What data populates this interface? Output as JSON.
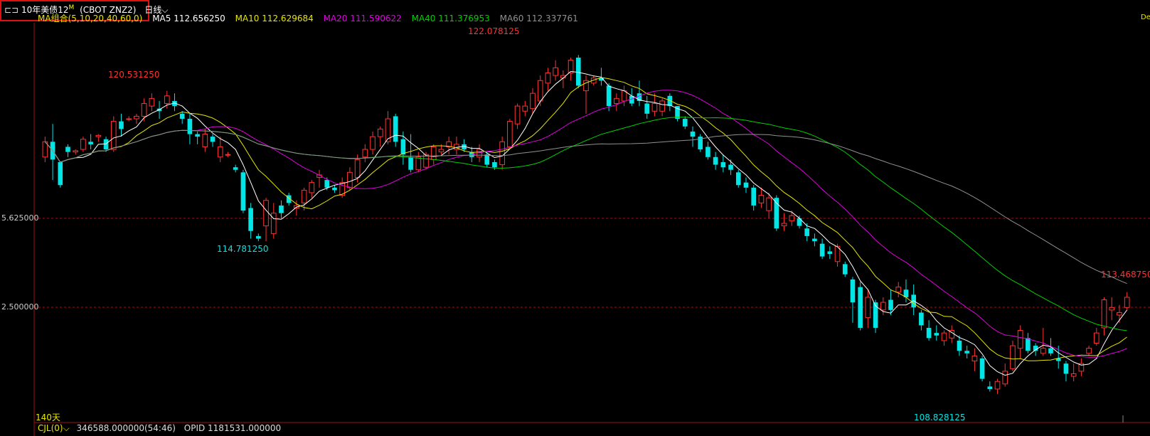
{
  "header": {
    "symbol_prefix": "10年美债12",
    "symbol_sup": "M",
    "symbol_code": "(CBOT ZNZ2)",
    "period": "日线",
    "period_arrow": "⌵"
  },
  "ma_bar": {
    "group": "MA组合(5,10,20,40,60,0)",
    "ma5": "MA5 112.656250",
    "ma10": "MA10 112.629684",
    "ma20": "MA20 111.590622",
    "ma40": "MA40 111.376953",
    "ma60": "MA60 112.337761"
  },
  "y_axis": {
    "label_1": "5.625000",
    "label_2": "2.500000"
  },
  "annotations": {
    "high": "122.078125",
    "peak_left": "120.531250",
    "low_left": "114.781250",
    "low": "108.828125",
    "last": "113.468750",
    "count": "140天",
    "corner": "De"
  },
  "indicator_bar": {
    "name": "CJL(0)",
    "arrow": "⌵",
    "value": "346588.000000(54:46)",
    "opid": "OPID 1181531.000000"
  },
  "colors": {
    "up": "#ff3232",
    "down": "#00e5e5",
    "ma5": "#ffffff",
    "ma10": "#e6e600",
    "ma20": "#e000e0",
    "ma40": "#00d000",
    "ma60": "#909090",
    "grid": "#a01010"
  },
  "chart_data": {
    "type": "candlestick",
    "price_range": [
      107.8,
      123.2
    ],
    "bars": [
      [
        118.1,
        118.9,
        117.9,
        118.7
      ],
      [
        118.7,
        119.4,
        117.2,
        118.0
      ],
      [
        117.9,
        117.9,
        116.9,
        117.0
      ],
      [
        118.5,
        118.6,
        118.1,
        118.3
      ],
      [
        118.3,
        118.4,
        118.2,
        118.35
      ],
      [
        118.4,
        118.9,
        118.3,
        118.8
      ],
      [
        118.7,
        119.0,
        118.4,
        118.6
      ],
      [
        118.9,
        119.0,
        118.7,
        118.95
      ],
      [
        118.8,
        118.9,
        118.3,
        118.4
      ],
      [
        118.4,
        119.7,
        118.3,
        119.5
      ],
      [
        119.5,
        119.8,
        118.9,
        119.2
      ],
      [
        119.6,
        119.7,
        119.5,
        119.6
      ],
      [
        119.6,
        119.8,
        119.4,
        119.7
      ],
      [
        119.7,
        120.4,
        119.5,
        120.2
      ],
      [
        120.1,
        120.6,
        119.9,
        120.4
      ],
      [
        120.0,
        120.3,
        119.6,
        119.9
      ],
      [
        120.2,
        120.7,
        120.0,
        120.5
      ],
      [
        120.3,
        120.6,
        119.9,
        120.1
      ],
      [
        119.8,
        119.9,
        119.4,
        119.6
      ],
      [
        119.6,
        119.8,
        118.6,
        119.0
      ],
      [
        119.0,
        119.1,
        118.6,
        118.9
      ],
      [
        118.5,
        119.2,
        118.3,
        119.0
      ],
      [
        118.9,
        119.0,
        118.5,
        118.7
      ],
      [
        118.1,
        118.9,
        117.9,
        118.5
      ],
      [
        118.2,
        118.3,
        118.1,
        118.2
      ],
      [
        117.7,
        117.8,
        117.5,
        117.6
      ],
      [
        117.5,
        117.6,
        115.9,
        116.0
      ],
      [
        116.1,
        116.3,
        114.9,
        115.2
      ],
      [
        115.0,
        115.1,
        114.8,
        114.9
      ],
      [
        115.4,
        116.5,
        114.8,
        116.4
      ],
      [
        115.1,
        116.3,
        114.9,
        115.9
      ],
      [
        116.2,
        116.4,
        115.7,
        115.9
      ],
      [
        116.6,
        116.7,
        116.2,
        116.3
      ],
      [
        116.1,
        116.4,
        115.8,
        116.2
      ],
      [
        116.3,
        116.9,
        116.0,
        116.8
      ],
      [
        116.7,
        117.2,
        116.5,
        117.1
      ],
      [
        117.3,
        117.6,
        116.9,
        117.4
      ],
      [
        117.2,
        117.3,
        116.8,
        116.9
      ],
      [
        116.9,
        117.0,
        116.7,
        116.8
      ],
      [
        116.6,
        117.3,
        116.5,
        117.1
      ],
      [
        116.9,
        117.7,
        116.8,
        117.5
      ],
      [
        117.3,
        118.2,
        117.1,
        118.0
      ],
      [
        118.1,
        118.6,
        117.9,
        118.4
      ],
      [
        118.4,
        119.1,
        118.2,
        118.9
      ],
      [
        118.9,
        119.3,
        118.5,
        119.2
      ],
      [
        118.7,
        119.9,
        118.6,
        119.6
      ],
      [
        119.7,
        119.8,
        118.5,
        118.7
      ],
      [
        118.8,
        119.1,
        117.8,
        118.2
      ],
      [
        118.1,
        119.0,
        117.5,
        117.6
      ],
      [
        117.6,
        118.3,
        117.5,
        118.1
      ],
      [
        117.7,
        118.3,
        117.6,
        118.2
      ],
      [
        118.0,
        118.6,
        117.8,
        118.5
      ],
      [
        118.3,
        118.6,
        118.2,
        118.4
      ],
      [
        118.5,
        118.9,
        118.2,
        118.7
      ],
      [
        118.4,
        118.9,
        118.2,
        118.6
      ],
      [
        118.6,
        118.8,
        118.3,
        118.4
      ],
      [
        118.3,
        118.5,
        117.9,
        118.1
      ],
      [
        118.1,
        118.6,
        117.9,
        118.4
      ],
      [
        118.2,
        118.3,
        117.7,
        117.8
      ],
      [
        117.9,
        118.0,
        117.6,
        117.7
      ],
      [
        117.8,
        118.9,
        117.6,
        118.7
      ],
      [
        118.5,
        119.6,
        118.4,
        119.5
      ],
      [
        119.4,
        120.2,
        119.2,
        120.1
      ],
      [
        119.9,
        120.3,
        119.7,
        120.1
      ],
      [
        120.0,
        120.8,
        119.8,
        120.6
      ],
      [
        120.3,
        121.3,
        120.1,
        121.1
      ],
      [
        121.0,
        121.6,
        120.7,
        121.4
      ],
      [
        121.3,
        121.9,
        121.1,
        121.6
      ],
      [
        121.2,
        121.5,
        120.8,
        121.3
      ],
      [
        121.4,
        122.0,
        121.1,
        121.9
      ],
      [
        122.0,
        122.1,
        120.8,
        120.9
      ],
      [
        120.7,
        121.3,
        119.8,
        121.1
      ],
      [
        121.0,
        121.3,
        120.9,
        121.2
      ],
      [
        121.2,
        121.6,
        120.9,
        121.1
      ],
      [
        120.9,
        121.0,
        119.9,
        120.1
      ],
      [
        120.2,
        120.6,
        119.9,
        120.4
      ],
      [
        120.3,
        120.9,
        120.1,
        120.7
      ],
      [
        120.5,
        120.8,
        120.1,
        120.2
      ],
      [
        120.6,
        121.1,
        120.1,
        120.3
      ],
      [
        120.2,
        120.5,
        119.6,
        119.8
      ],
      [
        119.9,
        120.6,
        119.7,
        120.2
      ],
      [
        119.9,
        120.4,
        119.7,
        120.3
      ],
      [
        120.5,
        120.6,
        119.9,
        120.1
      ],
      [
        120.1,
        120.1,
        119.5,
        119.6
      ],
      [
        119.6,
        119.7,
        119.2,
        119.3
      ],
      [
        119.1,
        119.3,
        118.5,
        118.9
      ],
      [
        118.9,
        119.0,
        118.3,
        118.4
      ],
      [
        118.5,
        118.7,
        118.0,
        118.1
      ],
      [
        118.1,
        118.3,
        117.6,
        117.8
      ],
      [
        117.9,
        118.2,
        117.5,
        117.7
      ],
      [
        117.8,
        118.0,
        117.4,
        117.6
      ],
      [
        117.5,
        117.6,
        116.9,
        117.0
      ],
      [
        117.1,
        117.3,
        116.7,
        116.9
      ],
      [
        116.9,
        117.0,
        116.0,
        116.2
      ],
      [
        116.3,
        116.9,
        116.1,
        116.6
      ],
      [
        116.0,
        116.7,
        115.7,
        116.5
      ],
      [
        116.5,
        116.6,
        115.2,
        115.3
      ],
      [
        115.4,
        115.9,
        115.2,
        115.5
      ],
      [
        115.6,
        116.0,
        115.4,
        115.8
      ],
      [
        115.7,
        115.8,
        115.3,
        115.4
      ],
      [
        115.3,
        115.5,
        114.8,
        115.0
      ],
      [
        114.9,
        115.1,
        114.6,
        114.8
      ],
      [
        114.7,
        114.9,
        114.1,
        114.2
      ],
      [
        114.4,
        114.6,
        114.1,
        114.3
      ],
      [
        114.0,
        114.7,
        113.8,
        114.6
      ],
      [
        113.9,
        114.0,
        113.4,
        113.5
      ],
      [
        113.3,
        113.4,
        111.6,
        112.4
      ],
      [
        113.0,
        113.2,
        111.3,
        111.4
      ],
      [
        111.8,
        112.9,
        111.4,
        112.6
      ],
      [
        112.4,
        112.5,
        111.2,
        111.4
      ],
      [
        112.1,
        112.6,
        111.9,
        112.4
      ],
      [
        112.5,
        112.9,
        111.9,
        112.1
      ],
      [
        112.8,
        113.2,
        112.6,
        113.0
      ],
      [
        112.9,
        113.3,
        112.4,
        112.6
      ],
      [
        112.7,
        113.1,
        111.9,
        112.2
      ],
      [
        112.0,
        112.1,
        111.3,
        111.5
      ],
      [
        111.4,
        111.7,
        110.9,
        111.0
      ],
      [
        111.2,
        111.5,
        110.9,
        111.1
      ],
      [
        110.9,
        111.3,
        110.7,
        111.2
      ],
      [
        111.0,
        111.5,
        110.8,
        111.3
      ],
      [
        110.9,
        111.1,
        110.3,
        110.5
      ],
      [
        110.5,
        110.7,
        110.2,
        110.4
      ],
      [
        110.1,
        110.6,
        109.7,
        110.3
      ],
      [
        110.2,
        110.3,
        109.3,
        109.4
      ],
      [
        109.1,
        109.3,
        108.9,
        109.0
      ],
      [
        109.0,
        109.4,
        108.8,
        109.3
      ],
      [
        109.2,
        110.0,
        109.1,
        109.7
      ],
      [
        109.8,
        110.9,
        109.7,
        110.7
      ],
      [
        110.6,
        111.5,
        110.2,
        111.3
      ],
      [
        111.0,
        111.2,
        110.4,
        110.5
      ],
      [
        110.7,
        110.8,
        110.3,
        110.5
      ],
      [
        110.4,
        111.4,
        110.3,
        110.6
      ],
      [
        110.6,
        111.0,
        110.3,
        110.4
      ],
      [
        110.2,
        110.7,
        109.8,
        110.1
      ],
      [
        110.0,
        110.1,
        109.3,
        109.6
      ],
      [
        109.5,
        110.0,
        109.3,
        109.6
      ],
      [
        109.7,
        110.2,
        109.5,
        110.0
      ],
      [
        110.4,
        110.7,
        110.3,
        110.6
      ],
      [
        110.8,
        111.4,
        110.7,
        111.2
      ],
      [
        111.4,
        112.6,
        111.1,
        112.5
      ],
      [
        112.1,
        112.6,
        111.7,
        112.2
      ],
      [
        111.9,
        112.3,
        111.6,
        112.0
      ],
      [
        112.2,
        112.8,
        112.1,
        112.6
      ]
    ]
  }
}
